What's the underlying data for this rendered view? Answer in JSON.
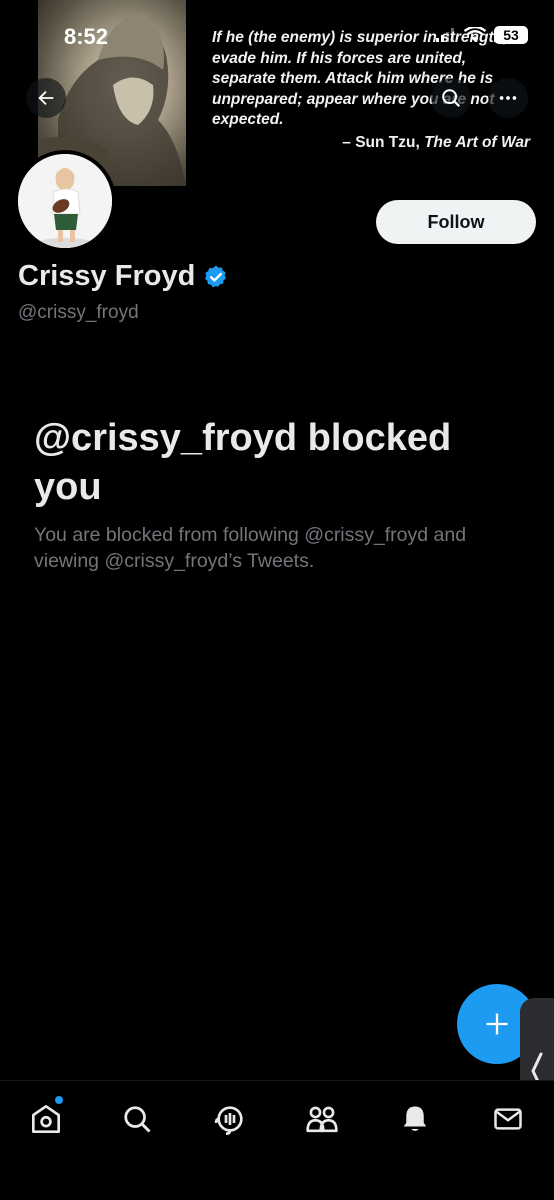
{
  "status_bar": {
    "time": "8:52",
    "battery": "53"
  },
  "banner": {
    "quote": "If he (the enemy) is superior in strength, evade him. If his forces are united, separate them. Attack him where he is unprepared; appear where you are not expected.",
    "attribution_prefix": "– Sun Tzu, ",
    "attribution_work": "The Art of War"
  },
  "profile": {
    "display_name": "Crissy Froyd",
    "handle": "@crissy_froyd",
    "verified": true,
    "follow_label": "Follow"
  },
  "blocked": {
    "title": "@crissy_froyd blocked you",
    "message": "You are blocked from following @crissy_froyd and viewing @crissy_froyd’s Tweets."
  },
  "tabs": [
    {
      "icon": "home-icon",
      "notification_dot": true
    },
    {
      "icon": "search-icon"
    },
    {
      "icon": "spaces-icon"
    },
    {
      "icon": "communities-icon"
    },
    {
      "icon": "bell-icon"
    },
    {
      "icon": "mail-icon"
    }
  ],
  "colors": {
    "accent": "#1d9bf0",
    "background": "#000000",
    "secondary_text": "#71767b"
  }
}
